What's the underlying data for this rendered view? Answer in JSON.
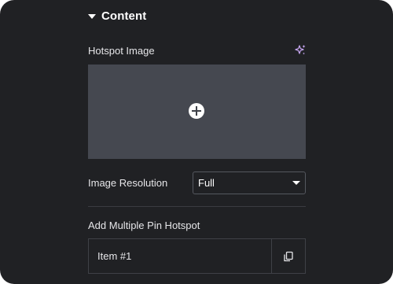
{
  "section": {
    "title": "Content",
    "expanded": true
  },
  "hotspot_image": {
    "label": "Hotspot Image",
    "ai_icon": "sparkle-icon",
    "add_icon": "plus-circle-icon"
  },
  "image_resolution": {
    "label": "Image Resolution",
    "selected": "Full",
    "icon": "chevron-down-icon"
  },
  "pin_hotspot": {
    "label": "Add Multiple Pin Hotspot",
    "items": [
      {
        "title": "Item #1",
        "action_icon": "duplicate-icon"
      }
    ]
  },
  "colors": {
    "panel_bg": "#202124",
    "image_placeholder": "#454850",
    "text": "#e6e6e9",
    "ai_accent": "#c9a8f5"
  }
}
